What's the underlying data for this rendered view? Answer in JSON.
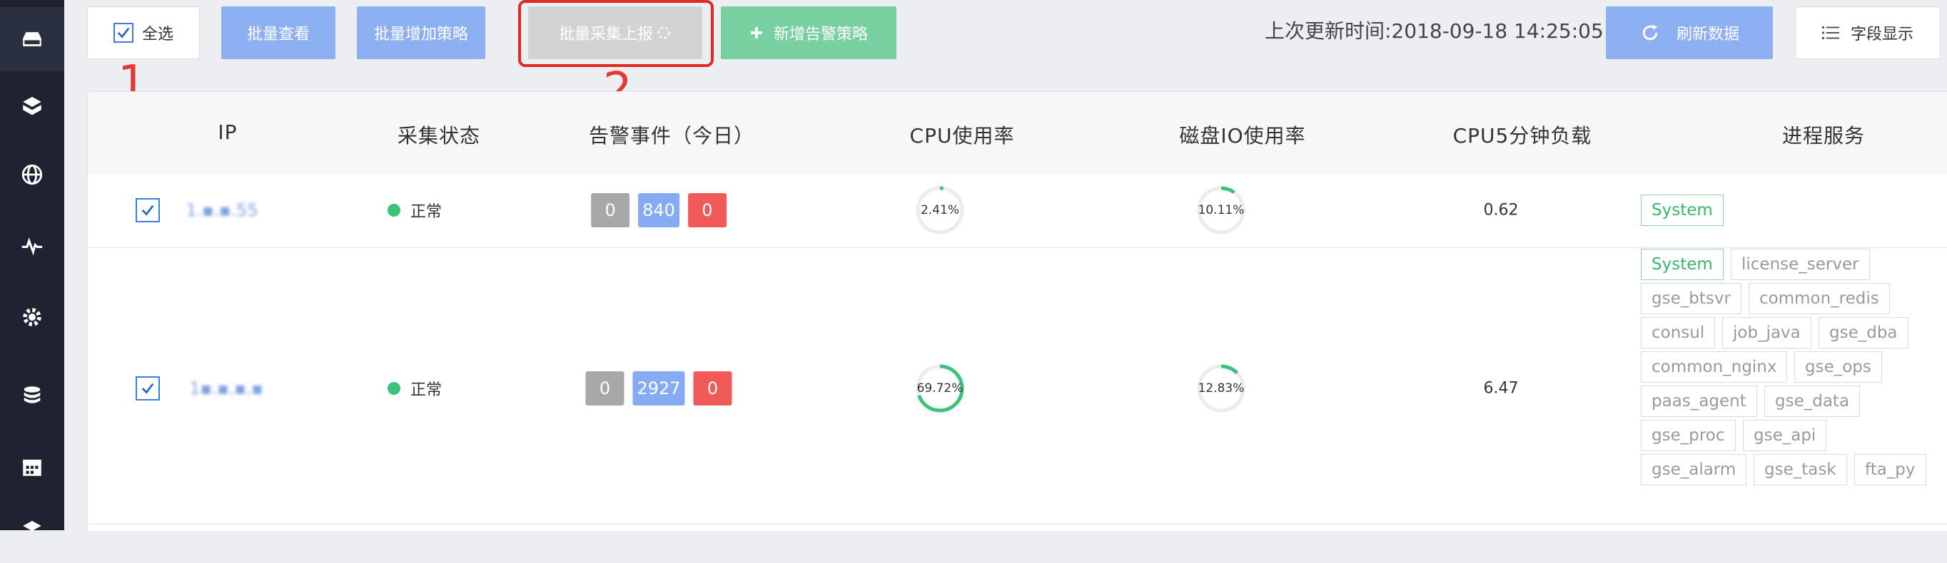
{
  "toolbar": {
    "select_all": "全选",
    "batch_view": "批量查看",
    "batch_add_policy": "批量增加策略",
    "batch_collect_report": "批量采集上报",
    "new_alarm_policy": "新增告警策略",
    "last_update": "上次更新时间:2018-09-18 14:25:05",
    "refresh": "刷新数据",
    "field_display": "字段显示"
  },
  "annotations": {
    "marker1": "1",
    "marker2": "2"
  },
  "table": {
    "headers": [
      "IP",
      "采集状态",
      "告警事件（今日）",
      "CPU使用率",
      "磁盘IO使用率",
      "CPU5分钟负载",
      "进程服务"
    ],
    "rows": [
      {
        "ip": "1.▪.▪.55",
        "status": "正常",
        "events": [
          "0",
          "840",
          "0"
        ],
        "cpu": "2.41%",
        "cpu_value": 2.41,
        "disk_io": "10.11%",
        "disk_io_value": 10.11,
        "load5": "0.62",
        "processes": [
          "System"
        ]
      },
      {
        "ip": "1▪.▪.▪.▪",
        "status": "正常",
        "events": [
          "0",
          "2927",
          "0"
        ],
        "cpu": "69.72%",
        "cpu_value": 69.72,
        "disk_io": "12.83%",
        "disk_io_value": 12.83,
        "load5": "6.47",
        "processes": [
          "System",
          "license_server",
          "gse_btsvr",
          "common_redis",
          "consul",
          "job_java",
          "gse_dba",
          "common_nginx",
          "gse_ops",
          "paas_agent",
          "gse_data",
          "gse_proc",
          "gse_api",
          "gse_alarm",
          "gse_task",
          "fta_py"
        ]
      }
    ]
  },
  "colors": {
    "sidebar": "#1f2331",
    "primary": "#8db0f2",
    "success": "#78cf9f",
    "danger": "#f25a5a",
    "highlight": "#e02b24"
  },
  "icons": [
    "server-icon",
    "cube-icon",
    "globe-icon",
    "pulse-icon",
    "gear-icon",
    "database-icon",
    "calendar-icon",
    "box-icon",
    "refresh-icon",
    "list-icon",
    "plus-icon",
    "loading-icon",
    "check-icon"
  ]
}
